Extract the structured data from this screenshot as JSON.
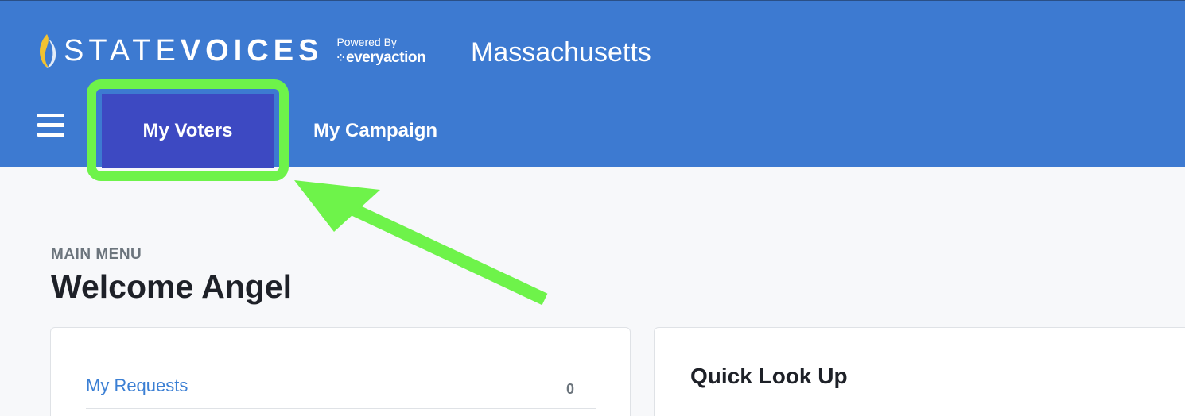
{
  "header": {
    "brand": {
      "word_light": "STATE",
      "word_bold": "VOICES"
    },
    "powered_by": {
      "label": "Powered By",
      "partner": "everyaction"
    },
    "state": "Massachusetts",
    "menu_icon": "hamburger-icon",
    "nav": [
      {
        "label": "My Voters",
        "selected": true
      },
      {
        "label": "My Campaign",
        "selected": false
      }
    ]
  },
  "main": {
    "eyebrow": "MAIN MENU",
    "title": "Welcome Angel",
    "requests": {
      "label": "My Requests",
      "count": "0"
    },
    "quick_lookup": {
      "title": "Quick Look Up"
    }
  },
  "annotation": {
    "highlight_color": "#6ef34a",
    "target": "My Voters"
  },
  "colors": {
    "header_bg": "#3d7ad1",
    "active_tab_bg": "#3d49c2",
    "link": "#3b7fd4",
    "page_bg": "#f7f8fa"
  }
}
